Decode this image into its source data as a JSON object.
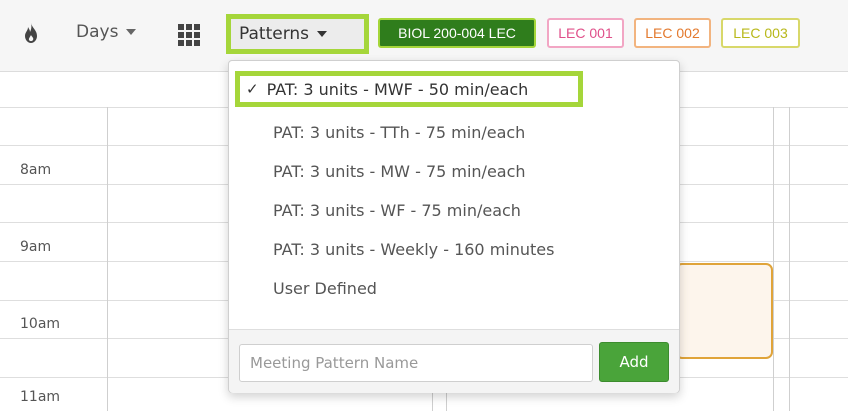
{
  "toolbar": {
    "days_label": "Days",
    "patterns_label": "Patterns",
    "chips": [
      {
        "label": "BIOL 200-004 LEC"
      },
      {
        "label": "LEC 001"
      },
      {
        "label": "LEC 002"
      },
      {
        "label": "LEC 003"
      }
    ]
  },
  "calendar": {
    "times": [
      "8am",
      "9am",
      "10am",
      "11am"
    ]
  },
  "dropdown": {
    "items": [
      {
        "label": "PAT: 3 units - MWF - 50 min/each",
        "selected": true
      },
      {
        "label": "PAT: 3 units - TTh - 75 min/each"
      },
      {
        "label": "PAT: 3 units - MW - 75 min/each"
      },
      {
        "label": "PAT: 3 units - WF - 75 min/each"
      },
      {
        "label": "PAT: 3 units - Weekly - 160 minutes"
      },
      {
        "label": "User Defined"
      }
    ],
    "check_glyph": "✓",
    "input_placeholder": "Meeting Pattern Name",
    "add_label": "Add"
  },
  "colors": {
    "highlight": "#a5d63a",
    "biol_chip": "#2f7d1c",
    "lec001": "#e0508a",
    "lec002": "#e3792d",
    "lec003": "#b8b81a",
    "add_button": "#4aa43a",
    "event_border": "#e0a43a"
  }
}
